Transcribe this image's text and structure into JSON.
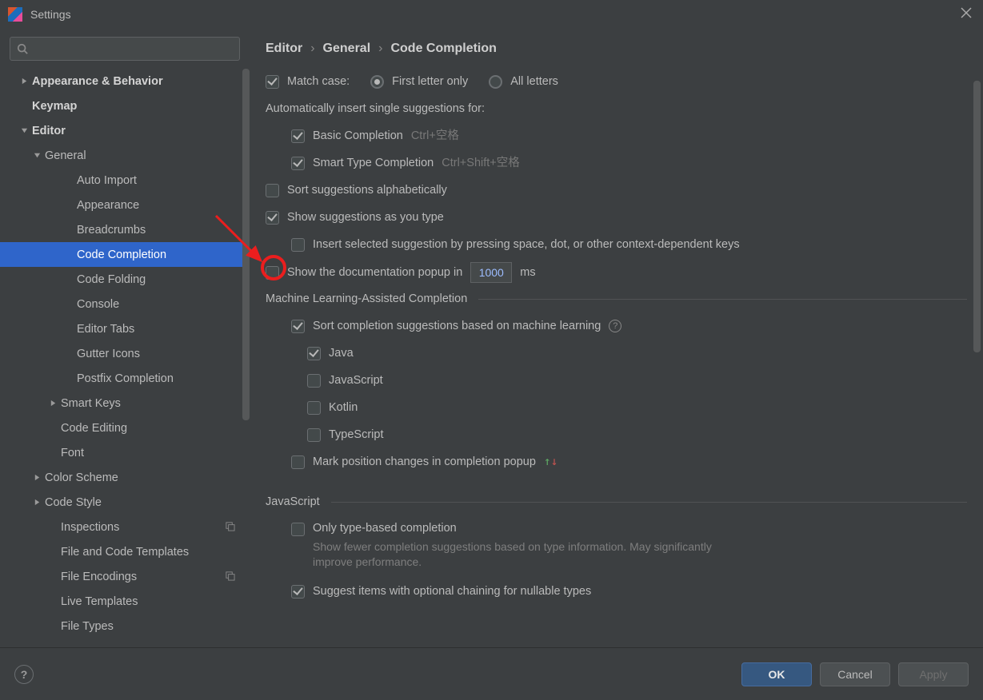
{
  "window": {
    "title": "Settings"
  },
  "breadcrumb": {
    "a": "Editor",
    "b": "General",
    "c": "Code Completion"
  },
  "sidebar": {
    "items": [
      {
        "label": "Appearance & Behavior",
        "bold": true,
        "chev": "right",
        "indent": 0
      },
      {
        "label": "Keymap",
        "bold": true,
        "indent": 0
      },
      {
        "label": "Editor",
        "bold": true,
        "chev": "down",
        "indent": 0
      },
      {
        "label": "General",
        "chev": "down",
        "indent": 1
      },
      {
        "label": "Auto Import",
        "indent": 3
      },
      {
        "label": "Appearance",
        "indent": 3
      },
      {
        "label": "Breadcrumbs",
        "indent": 3
      },
      {
        "label": "Code Completion",
        "indent": 3,
        "selected": true
      },
      {
        "label": "Code Folding",
        "indent": 3
      },
      {
        "label": "Console",
        "indent": 3
      },
      {
        "label": "Editor Tabs",
        "indent": 3
      },
      {
        "label": "Gutter Icons",
        "indent": 3
      },
      {
        "label": "Postfix Completion",
        "indent": 3
      },
      {
        "label": "Smart Keys",
        "chev": "right",
        "indent": 2
      },
      {
        "label": "Code Editing",
        "indent": 2
      },
      {
        "label": "Font",
        "indent": 2
      },
      {
        "label": "Color Scheme",
        "chev": "right",
        "indent": 1
      },
      {
        "label": "Code Style",
        "chev": "right",
        "indent": 1
      },
      {
        "label": "Inspections",
        "indent": 2,
        "suffix": "copy"
      },
      {
        "label": "File and Code Templates",
        "indent": 2
      },
      {
        "label": "File Encodings",
        "indent": 2,
        "suffix": "copy"
      },
      {
        "label": "Live Templates",
        "indent": 2
      },
      {
        "label": "File Types",
        "indent": 2
      }
    ]
  },
  "options": {
    "match_case": {
      "label": "Match case:",
      "first_letter": "First letter only",
      "all_letters": "All letters"
    },
    "auto_insert_header": "Automatically insert single suggestions for:",
    "basic_completion": {
      "label": "Basic Completion",
      "shortcut": "Ctrl+空格"
    },
    "smart_completion": {
      "label": "Smart Type Completion",
      "shortcut": "Ctrl+Shift+空格"
    },
    "sort_alpha": "Sort suggestions alphabetically",
    "show_as_type": "Show suggestions as you type",
    "insert_selected": "Insert selected suggestion by pressing space, dot, or other context-dependent keys",
    "doc_popup": {
      "prefix": "Show the documentation popup in",
      "value": "1000",
      "suffix": "ms"
    },
    "ml_header": "Machine Learning-Assisted Completion",
    "ml_sort": "Sort completion suggestions based on machine learning",
    "ml_langs": {
      "java": "Java",
      "js": "JavaScript",
      "kotlin": "Kotlin",
      "ts": "TypeScript"
    },
    "mark_position": "Mark position changes in completion popup",
    "js_header": "JavaScript",
    "only_type": {
      "label": "Only type-based completion",
      "hint": "Show fewer completion suggestions based on type information. May significantly improve performance."
    },
    "suggest_optional": "Suggest items with optional chaining for nullable types"
  },
  "footer": {
    "ok": "OK",
    "cancel": "Cancel",
    "apply": "Apply"
  }
}
